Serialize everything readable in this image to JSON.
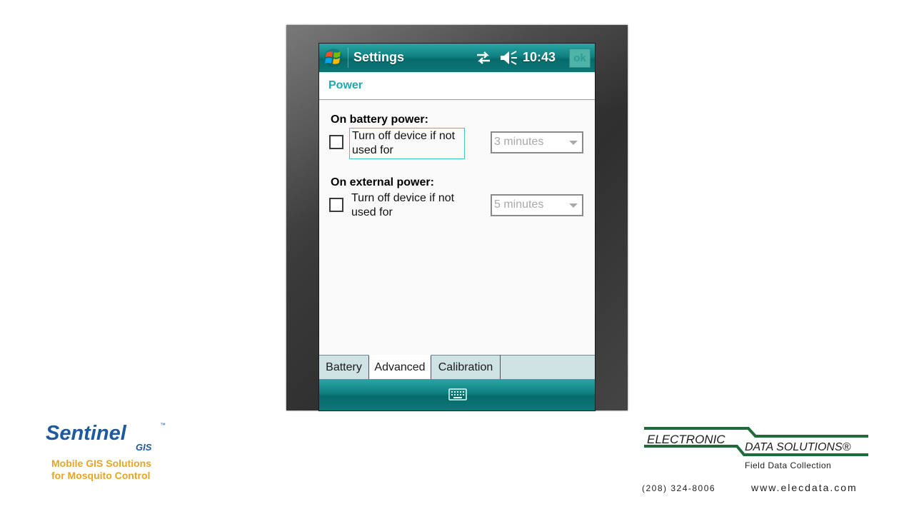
{
  "titlebar": {
    "title": "Settings",
    "time": "10:43",
    "ok_label": "ok",
    "icons": [
      "windows-start-icon",
      "connectivity-icon",
      "volume-muted-icon"
    ]
  },
  "header": {
    "title": "Power"
  },
  "battery": {
    "heading": "On battery power:",
    "checkbox_label": "Turn off device if not used for",
    "checked": false,
    "dropdown_value": "3 minutes"
  },
  "external": {
    "heading": "On external power:",
    "checkbox_label": "Turn off device if not used for",
    "checked": false,
    "dropdown_value": "5 minutes"
  },
  "tabs": [
    {
      "label": "Battery",
      "active": false
    },
    {
      "label": "Advanced",
      "active": true
    },
    {
      "label": "Calibration",
      "active": false
    }
  ],
  "bottombar": {
    "icon": "keyboard-icon"
  },
  "brand_left": {
    "name": "Sentinel",
    "sub": "GIS",
    "tm": "™",
    "tagline_1": "Mobile GIS Solutions",
    "tagline_2": "for Mosquito Control"
  },
  "brand_right": {
    "line_1": "ELECTRONIC",
    "line_2": "DATA SOLUTIONS®",
    "sub": "Field Data Collection",
    "phone": "(208) 324-8006",
    "website": "www.elecdata.com"
  },
  "colors": {
    "teal_bar": "#0f8080",
    "header_text": "#1aaab0",
    "sentinel_blue": "#1e5aa0",
    "sentinel_gold": "#e3a62b",
    "eds_green": "#1f6b3a"
  }
}
